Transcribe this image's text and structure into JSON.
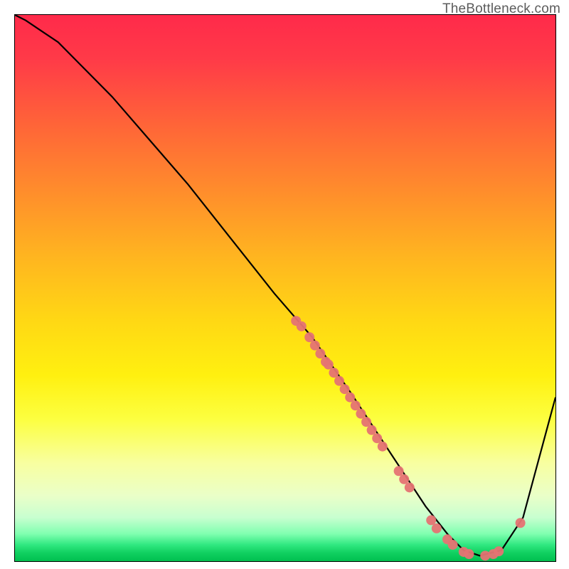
{
  "watermark": "TheBottleneck.com",
  "chart_data": {
    "type": "line",
    "title": "",
    "xlabel": "",
    "ylabel": "",
    "xlim": [
      0,
      100
    ],
    "ylim": [
      0,
      100
    ],
    "x": [
      0,
      2,
      5,
      8,
      12,
      18,
      25,
      32,
      40,
      48,
      55,
      62,
      68,
      72,
      76,
      80,
      83,
      86,
      90,
      94,
      100
    ],
    "y": [
      100,
      99,
      97,
      95,
      91,
      85,
      77,
      69,
      59,
      49,
      41,
      31,
      22,
      16,
      10,
      5,
      2,
      1,
      2,
      8,
      30
    ],
    "scatter_points": [
      {
        "x": 52.0,
        "y": 44.0
      },
      {
        "x": 53.0,
        "y": 43.0
      },
      {
        "x": 54.5,
        "y": 41.0
      },
      {
        "x": 55.5,
        "y": 39.5
      },
      {
        "x": 56.5,
        "y": 38.0
      },
      {
        "x": 57.5,
        "y": 36.5
      },
      {
        "x": 58.0,
        "y": 36.0
      },
      {
        "x": 59.0,
        "y": 34.5
      },
      {
        "x": 60.0,
        "y": 33.0
      },
      {
        "x": 61.0,
        "y": 31.5
      },
      {
        "x": 62.0,
        "y": 30.0
      },
      {
        "x": 63.0,
        "y": 28.5
      },
      {
        "x": 64.0,
        "y": 27.0
      },
      {
        "x": 65.0,
        "y": 25.5
      },
      {
        "x": 66.0,
        "y": 24.0
      },
      {
        "x": 67.0,
        "y": 22.5
      },
      {
        "x": 68.0,
        "y": 21.0
      },
      {
        "x": 71.0,
        "y": 16.5
      },
      {
        "x": 72.0,
        "y": 15.0
      },
      {
        "x": 73.0,
        "y": 13.5
      },
      {
        "x": 77.0,
        "y": 7.5
      },
      {
        "x": 78.0,
        "y": 6.0
      },
      {
        "x": 80.0,
        "y": 4.0
      },
      {
        "x": 81.0,
        "y": 3.0
      },
      {
        "x": 83.0,
        "y": 1.7
      },
      {
        "x": 84.0,
        "y": 1.3
      },
      {
        "x": 87.0,
        "y": 1.0
      },
      {
        "x": 88.5,
        "y": 1.3
      },
      {
        "x": 89.5,
        "y": 1.8
      },
      {
        "x": 93.5,
        "y": 7.0
      }
    ],
    "scatter_color": "#e57373",
    "line_color": "#000000",
    "grid": false,
    "legend": false
  }
}
